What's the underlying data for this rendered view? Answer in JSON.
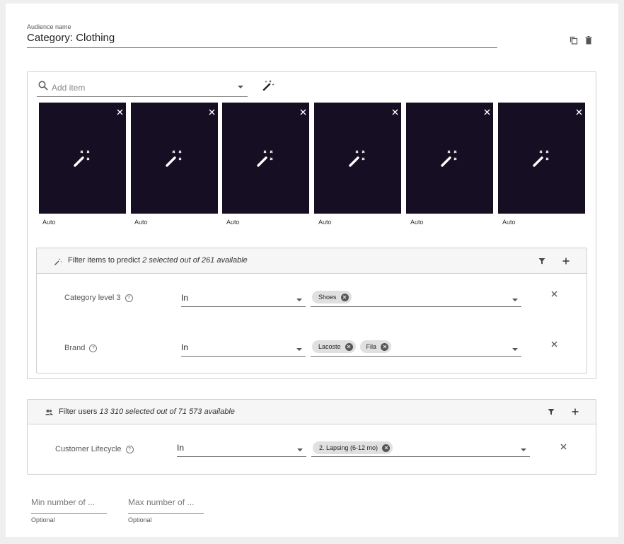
{
  "audience": {
    "label": "Audience name",
    "value": "Category: Clothing",
    "copy_icon": "copy-icon",
    "delete_icon": "trash-icon"
  },
  "items": {
    "search_placeholder": "Add item",
    "magic_icon": "magic-wand-icon",
    "tiles": [
      {
        "label": "Auto"
      },
      {
        "label": "Auto"
      },
      {
        "label": "Auto"
      },
      {
        "label": "Auto"
      },
      {
        "label": "Auto"
      },
      {
        "label": "Auto"
      }
    ]
  },
  "item_filter": {
    "title": "Filter items to predict",
    "summary": "2 selected out of 261 available",
    "rows": [
      {
        "label": "Category level 3",
        "operator": "In",
        "chips": [
          "Shoes"
        ]
      },
      {
        "label": "Brand",
        "operator": "In",
        "chips": [
          "Lacoste",
          "Fila"
        ]
      }
    ]
  },
  "user_filter": {
    "title": "Filter users",
    "summary": "13 310 selected out of 71 573 available",
    "rows": [
      {
        "label": "Customer Lifecycle",
        "operator": "In",
        "chips": [
          "2. Lapsing (6-12 mo)"
        ]
      }
    ]
  },
  "limits": {
    "min_placeholder": "Min number of ...",
    "max_placeholder": "Max number of ...",
    "min_hint": "Optional",
    "max_hint": "Optional"
  },
  "colors": {
    "tile_bg": "#160f23",
    "chip_bg": "#e0e0e0",
    "header_bg": "#f6f6f6"
  }
}
